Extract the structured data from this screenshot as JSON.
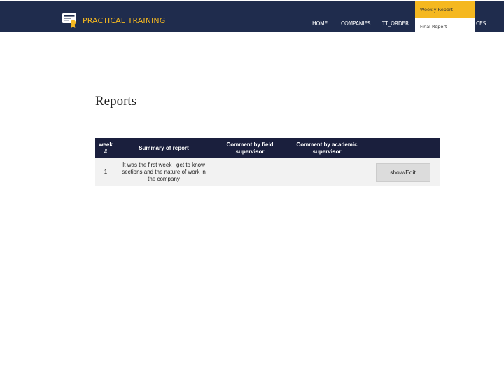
{
  "header": {
    "brand": "PRACTICAL TRAINING",
    "nav": {
      "home": "HOME",
      "companies": "COMPANIES",
      "tt_order": "TT_ORDER",
      "extra": "CES"
    },
    "dropdown": {
      "weekly_report": "Weekly Report",
      "final_report": "Final Report"
    },
    "colors": {
      "bar": "#1f2c4d",
      "brand_accent": "#f5b820",
      "table_header": "#1a1f3d"
    }
  },
  "main": {
    "title": "Reports",
    "table": {
      "headers": {
        "week": "week #",
        "summary": "Summary of report",
        "field_comment": "Comment by field supervisor",
        "academic_comment": "Comment by academic supervisor",
        "action": ""
      },
      "rows": [
        {
          "week": "1",
          "summary": "It was the first week I get to know sections and the nature of work in the company",
          "field_comment": "",
          "academic_comment": "",
          "action_label": "show/Edit"
        }
      ]
    }
  }
}
